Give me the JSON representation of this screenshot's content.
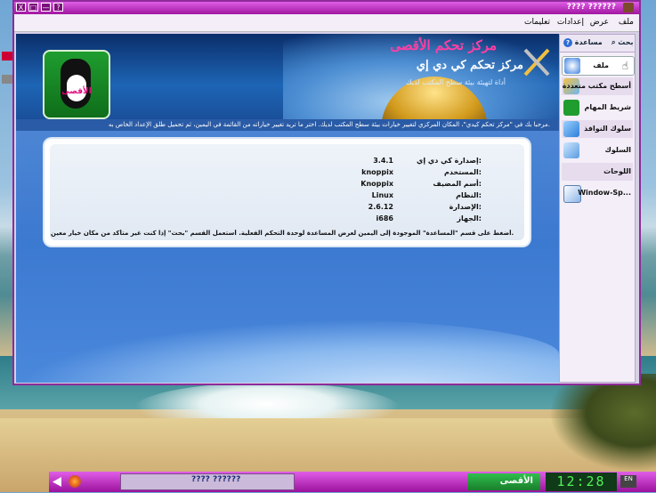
{
  "window": {
    "title": "???? ??????",
    "controls": [
      "X",
      "□",
      "—",
      "?"
    ]
  },
  "menu": {
    "items": [
      "ملف",
      "عرض",
      "إعدادات",
      "تعليمات"
    ]
  },
  "sidebar": {
    "tabs": [
      "مساعدة",
      "بحث"
    ],
    "items": [
      {
        "label": "ملف",
        "icon": "back-arrow-icon"
      },
      {
        "label": "أسطح مكتب متعددة",
        "icon": "multi-desktop-icon"
      },
      {
        "label": "شريط المهام",
        "icon": "penguin-icon"
      },
      {
        "label": "سلوك النوافذ",
        "icon": "window-behavior-icon"
      },
      {
        "label": "السلوك",
        "icon": "behavior-icon"
      },
      {
        "label": "اللوحات",
        "icon": "panels-icon"
      },
      {
        "label": "Window-Sp...",
        "icon": "window-specific-icon"
      }
    ]
  },
  "banner": {
    "logo_label": "الأقصى",
    "title_main": "مركز تحكم الأقصى",
    "title_sub": "مركز تحكم كي دي إي",
    "tagline": "أداة لتهيئة بيئة سطح المكتب لديك"
  },
  "intro_text": "مرحبا بك في \"مركز تحكم كيدي\"، المكان المركزي لتغيير خيارات بيئة سطح المكتب لديك. اختر ما تريد تغيير خياراته من القائمة في اليمين، ثم تحميل طلق الإعداد الخاص به.",
  "info": {
    "rows": [
      {
        "label": "إصدارة كي دي إي:",
        "value": "3.4.1"
      },
      {
        "label": "المستخدم:",
        "value": "knoppix"
      },
      {
        "label": "أسم المضيف:",
        "value": "Knoppix"
      },
      {
        "label": "النظام:",
        "value": "Linux"
      },
      {
        "label": "الإصدارة:",
        "value": "2.6.12"
      },
      {
        "label": "الجهاز:",
        "value": "i686"
      }
    ],
    "note": "أضغط على قسم \"المساعدة\" الموجودة إلى اليمين لعرض المساعدة لوحدة التحكم الفعلية. أستعمل القسم \"بحث\" إذا كنت غير متأكد من مكان خيار معين."
  },
  "taskbar": {
    "task_label": "???? ??????",
    "pager_label": "الأقصى",
    "clock": "12:28",
    "tray": "EN"
  },
  "colors": {
    "title_gradient_top": "#e05ee7",
    "title_gradient_bottom": "#a0169f",
    "content_blue": "#3c79d0",
    "brand_pink": "#ff3fa3",
    "clock_green": "#54f05a"
  }
}
